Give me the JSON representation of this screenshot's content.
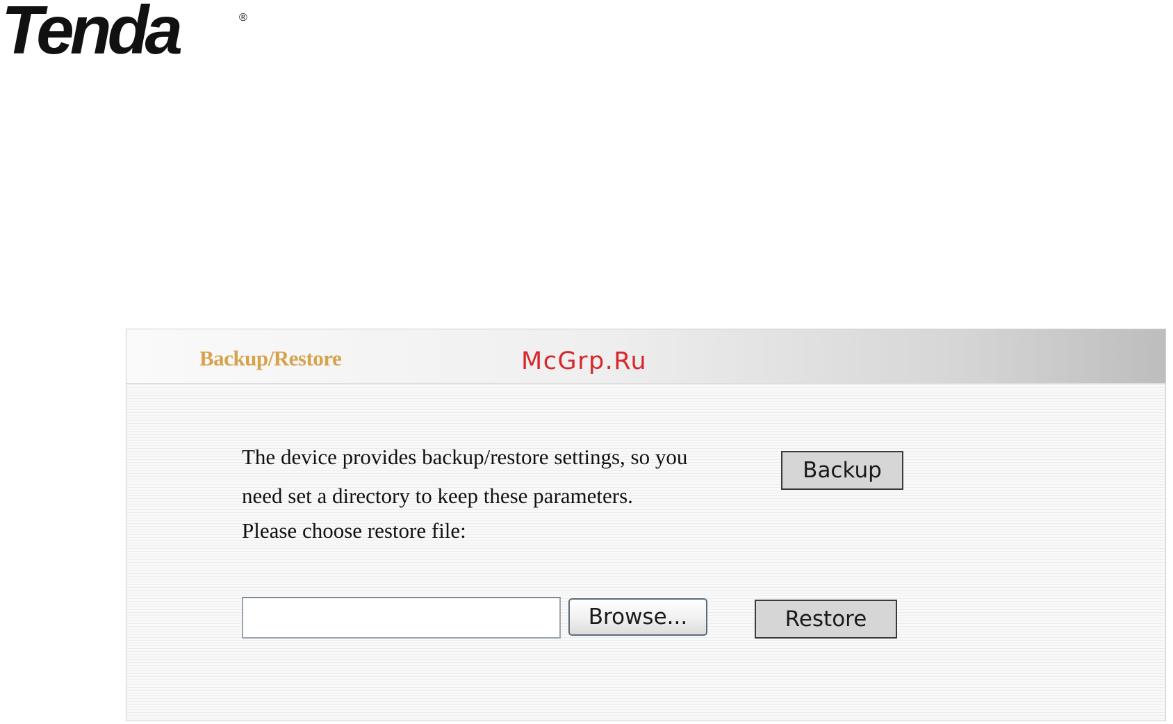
{
  "brand": {
    "logo_text": "Tenda",
    "registered_mark": "®"
  },
  "panel": {
    "title": "Backup/Restore",
    "watermark": "McGrp.Ru",
    "description_line1": "The device provides backup/restore settings, so you",
    "description_line2": "need set a directory to keep these parameters.",
    "restore_prompt": "Please choose restore file:",
    "backup_button_label": "Backup",
    "restore_file_value": "",
    "browse_button_label": "Browse...",
    "restore_button_label": "Restore"
  },
  "colors": {
    "title": "#d7a24c",
    "watermark": "#d9262b",
    "text": "#111111"
  }
}
